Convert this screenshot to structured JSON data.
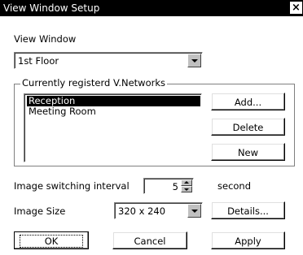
{
  "window": {
    "title": "View Window Setup",
    "close_glyph": "×"
  },
  "view_window": {
    "label": "View Window",
    "selected": "1st Floor"
  },
  "networks": {
    "caption": "Currently registerd V.Networks",
    "items": [
      "Reception",
      "Meeting Room"
    ],
    "selected_index": 0,
    "add_label": "Add...",
    "delete_label": "Delete",
    "new_label": "New"
  },
  "interval": {
    "label": "Image switching interval",
    "value": "5",
    "unit": "second"
  },
  "image_size": {
    "label": "Image Size",
    "selected": "320 x 240",
    "details_label": "Details..."
  },
  "footer": {
    "ok_label": "OK",
    "cancel_label": "Cancel",
    "apply_label": "Apply"
  }
}
